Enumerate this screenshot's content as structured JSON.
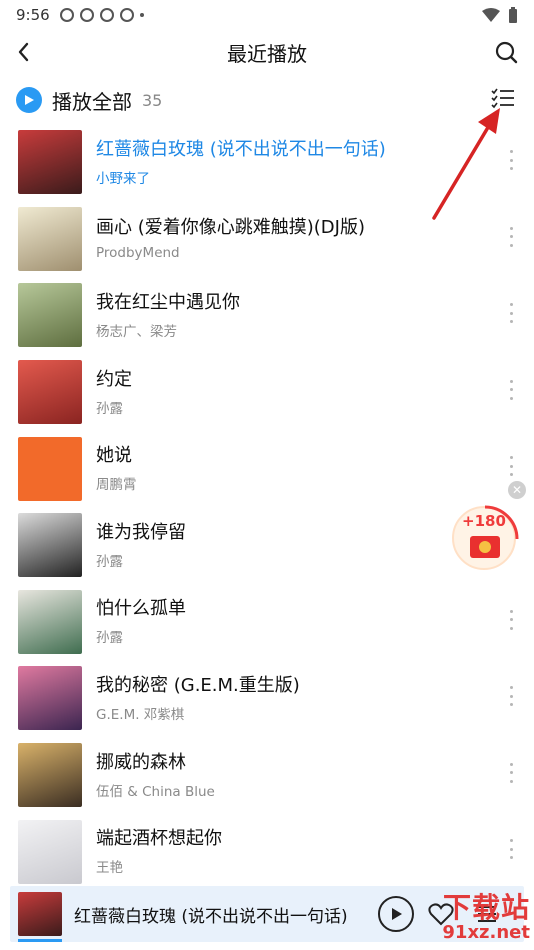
{
  "status_bar": {
    "time": "9:56"
  },
  "header": {
    "title": "最近播放"
  },
  "play_all": {
    "label": "播放全部",
    "count": "35"
  },
  "songs": [
    {
      "title": "红蔷薇白玫瑰 (说不出说不出一句话)",
      "artist": "小野来了",
      "active": true,
      "cover_color": "#7a2f2f"
    },
    {
      "title": "画心 (爱着你像心跳难触摸)(DJ版)",
      "artist": "ProdbyMend",
      "active": false,
      "cover_color": "#cfc6a6"
    },
    {
      "title": "我在红尘中遇见你",
      "artist": "杨志广、梁芳",
      "active": false,
      "cover_color": "#8da36a"
    },
    {
      "title": "约定",
      "artist": "孙露",
      "active": false,
      "cover_color": "#c0423a"
    },
    {
      "title": "她说",
      "artist": "周鹏霄",
      "active": false,
      "cover_color": "#f06a2b"
    },
    {
      "title": "谁为我停留",
      "artist": "孙露",
      "active": false,
      "cover_color": "#3a3a3a"
    },
    {
      "title": "怕什么孤单",
      "artist": "孙露",
      "active": false,
      "cover_color": "#6f8a64"
    },
    {
      "title": "我的秘密 (G.E.M.重生版)",
      "artist": "G.E.M. 邓紫棋",
      "active": false,
      "cover_color": "#b25a7a"
    },
    {
      "title": "挪威的森林",
      "artist": "伍佰 & China Blue",
      "active": false,
      "cover_color": "#a08a52"
    },
    {
      "title": "端起酒杯想起你",
      "artist": "王艳",
      "active": false,
      "cover_color": "#e7e7ea"
    }
  ],
  "bonus": {
    "text": "+180"
  },
  "player": {
    "title": "红蔷薇白玫瑰 (说不出说不出一句话)",
    "cover_color": "#7a2f2f"
  },
  "watermark": {
    "top": "下载站",
    "bottom": "91xz.net"
  },
  "colors": {
    "accent": "#1f88e5",
    "arrow": "#d62424"
  }
}
